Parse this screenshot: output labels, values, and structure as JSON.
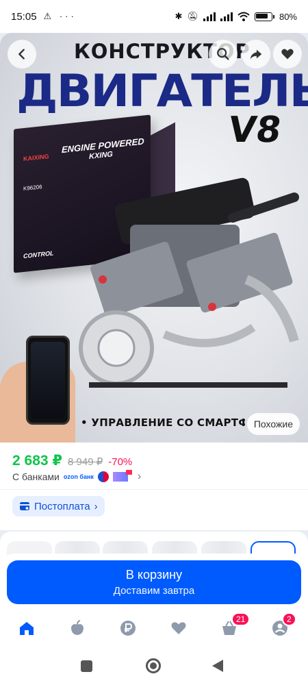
{
  "status_bar": {
    "time": "15:05",
    "left_icons": [
      "alert-icon",
      "more-dots-icon"
    ],
    "battery": "80%",
    "right_icons": [
      "bluetooth-icon",
      "mute-icon",
      "signal-icon",
      "signal-icon",
      "wifi-icon",
      "battery-icon"
    ]
  },
  "hero": {
    "title_line1": "КОНСТРУКТОР",
    "title_line2": "ДВИГАТЕЛЬ",
    "title_line3": "V8",
    "box_title": "ENGINE POWERED",
    "box_subtitle": "KXING",
    "box_brand": "KAIXING",
    "box_code": "K96206",
    "box_control": "CONTROL",
    "banner_text": "• УПРАВЛЕНИЕ СО СМАРТФОНА",
    "similar_label": "Похожие"
  },
  "price": {
    "current": "2 683 ₽",
    "old": "8 949 ₽",
    "discount": "-70%",
    "banks_label": "С банками",
    "ozon_bank": "ozon банк"
  },
  "postpay": {
    "label": "Постоплата",
    "chevron": "›"
  },
  "cart_button": {
    "label": "В корзину",
    "subtitle": "Доставим завтра"
  },
  "tabbar": {
    "items": [
      {
        "icon": "home-icon",
        "active": true
      },
      {
        "icon": "fresh-apple-icon"
      },
      {
        "icon": "ruble-icon"
      },
      {
        "icon": "heart-icon"
      },
      {
        "icon": "cart-icon",
        "badge": "21"
      },
      {
        "icon": "profile-icon",
        "badge": "2"
      }
    ]
  },
  "colors": {
    "accent": "#005bff",
    "price": "#10c44c",
    "discount": "#f91155",
    "badge": "#f91155",
    "title_blue": "#1b2a86"
  }
}
